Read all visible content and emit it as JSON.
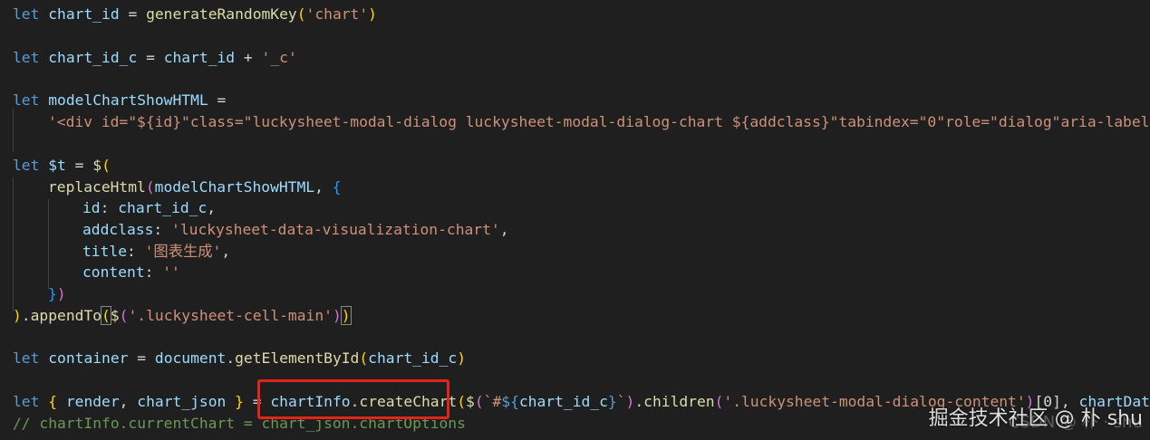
{
  "editor": {
    "theme_bg": "#1f1f1f",
    "lines": {
      "l1": {
        "let": "let",
        "name": "chart_id",
        "eq": " = ",
        "fn": "generateRandomKey",
        "open": "(",
        "arg": "'chart'",
        "close": ")"
      },
      "l2": {
        "let": "let",
        "name": "chart_id_c",
        "eq": " = ",
        "ref": "chart_id",
        "plus": " + ",
        "str": "'_c'"
      },
      "l3": {
        "let": "let",
        "name": "modelChartShowHTML",
        "eq": " ="
      },
      "l4": {
        "str": "'<div id=\"${id}\"class=\"luckysheet-modal-dialog luckysheet-modal-dialog-chart ${addclass}\"tabindex=\"0\"role=\"dialog\"aria-labelled"
      },
      "l5": {
        "let": "let",
        "name": "$t",
        "eq": " = ",
        "fn": "$",
        "open": "("
      },
      "l6": {
        "fn": "replaceHtml",
        "open": "(",
        "arg": "modelChartShowHTML",
        "comma": ", ",
        "brace": "{"
      },
      "l7": {
        "key": "id",
        "colon": ": ",
        "val": "chart_id_c",
        "comma": ","
      },
      "l8": {
        "key": "addclass",
        "colon": ": ",
        "val": "'luckysheet-data-visualization-chart'",
        "comma": ","
      },
      "l9": {
        "key": "title",
        "colon": ": ",
        "val": "'图表生成'",
        "comma": ","
      },
      "l10": {
        "key": "content",
        "colon": ": ",
        "val": "''"
      },
      "l11": {
        "brace": "}",
        "paren": ")"
      },
      "l12": {
        "close": ")",
        "dot": ".",
        "fn": "appendTo",
        "open": "(",
        "fn2": "$",
        "open2": "(",
        "str": "'.luckysheet-cell-main'",
        "close2": ")",
        "close3": ")"
      },
      "l13": {
        "let": "let",
        "name": "container",
        "eq": " = ",
        "obj": "document",
        "dot": ".",
        "fn": "getElementById",
        "open": "(",
        "arg": "chart_id_c",
        "close": ")"
      },
      "l14": {
        "let": "let",
        "brace_open": " { ",
        "p1": "render",
        "comma": ", ",
        "p2": "chart_json",
        "brace_close": " } ",
        "eq": "= ",
        "obj": "chartInfo",
        "dot": ".",
        "fn": "createChart",
        "open": "(",
        "fn2": "$",
        "open2": "(",
        "tpl1": "`#",
        "tpl_open": "${",
        "tpl_var": "chart_id_c",
        "tpl_close": "}",
        "tpl2": "`",
        "close2": ")",
        "dot2": ".",
        "fn3": "children",
        "open3": "(",
        "str": "'.luckysheet-modal-dialog-content'",
        "close3": ")",
        "idx": "[0]",
        "comma2": ", ",
        "arg2": "chartData",
        "comma3": ","
      },
      "l15": {
        "comment": "// chartInfo.currentChart = chart_json.chartOptions"
      }
    }
  },
  "watermark": {
    "main": "掘金技术社区 @ 朴 shu",
    "sub": "CSDN @ 朴 · shu"
  },
  "annotation": {
    "highlight_color": "#e1251b"
  }
}
